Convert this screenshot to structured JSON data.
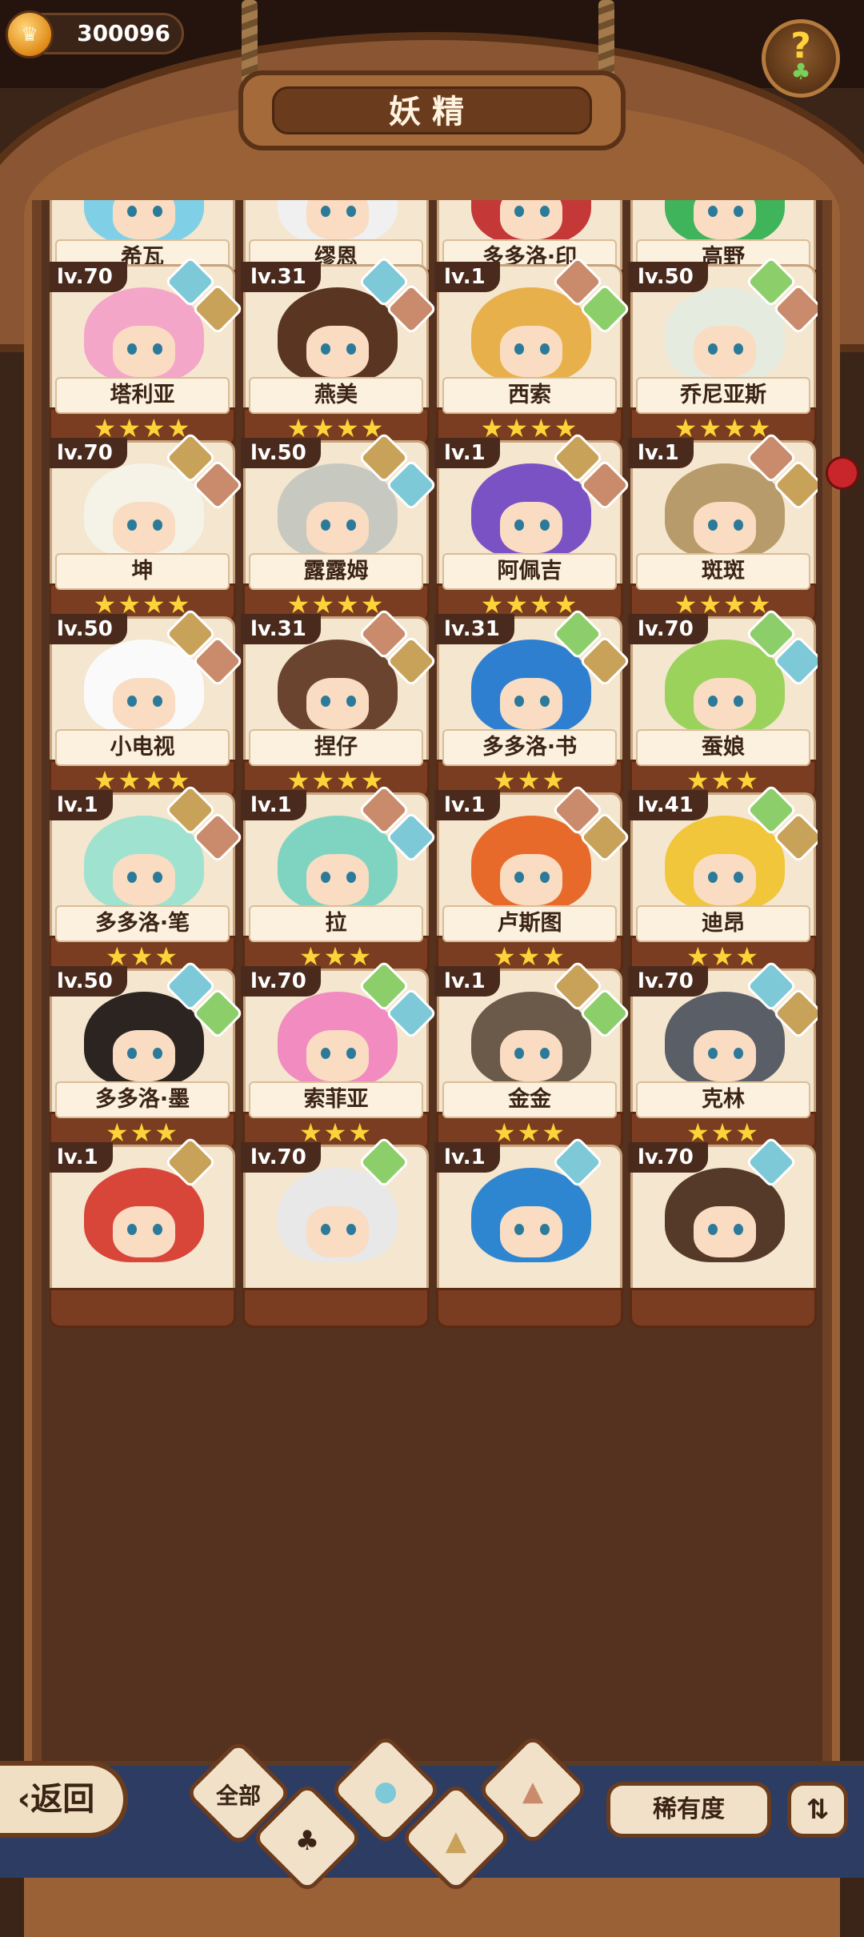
{
  "header": {
    "currency_amount": "300096",
    "title": "妖精",
    "help_symbol": "?"
  },
  "footer": {
    "back_label": "返回",
    "filter_all_label": "全部",
    "rarity_label": "稀有度",
    "sort_symbol": "⇅"
  },
  "colors": {
    "element_water": "#7dc9d8",
    "element_earth": "#c9a25a",
    "element_plant": "#8ccf6a",
    "element_fire": "#c98b6b"
  },
  "cards": [
    {
      "name": "希瓦",
      "level": "",
      "stars": "★★★★★",
      "elements": []
    },
    {
      "name": "缪恩",
      "level": "",
      "stars": "★★★★",
      "elements": []
    },
    {
      "name": "多多洛·印",
      "level": "",
      "stars": "★★★★",
      "elements": []
    },
    {
      "name": "高野",
      "level": "",
      "stars": "★★★★",
      "elements": []
    },
    {
      "name": "塔利亚",
      "level": "lv.70",
      "stars": "★★★★",
      "elements": [
        "water",
        "earth"
      ]
    },
    {
      "name": "燕美",
      "level": "lv.31",
      "stars": "★★★★",
      "elements": [
        "water",
        "fire"
      ]
    },
    {
      "name": "西索",
      "level": "lv.1",
      "stars": "★★★★",
      "elements": [
        "fire",
        "plant"
      ]
    },
    {
      "name": "乔尼亚斯",
      "level": "lv.50",
      "stars": "★★★★",
      "elements": [
        "plant",
        "fire"
      ]
    },
    {
      "name": "坤",
      "level": "lv.70",
      "stars": "★★★★",
      "elements": [
        "earth",
        "fire"
      ]
    },
    {
      "name": "露露姆",
      "level": "lv.50",
      "stars": "★★★★",
      "elements": [
        "earth",
        "water"
      ]
    },
    {
      "name": "阿佩吉",
      "level": "lv.1",
      "stars": "★★★★",
      "elements": [
        "earth",
        "fire"
      ]
    },
    {
      "name": "斑斑",
      "level": "lv.1",
      "stars": "★★★★",
      "elements": [
        "fire",
        "earth"
      ]
    },
    {
      "name": "小电视",
      "level": "lv.50",
      "stars": "★★★★",
      "elements": [
        "earth",
        "fire"
      ]
    },
    {
      "name": "捏仔",
      "level": "lv.31",
      "stars": "★★★★",
      "elements": [
        "fire",
        "earth"
      ]
    },
    {
      "name": "多多洛·书",
      "level": "lv.31",
      "stars": "★★★",
      "elements": [
        "plant",
        "earth"
      ]
    },
    {
      "name": "蚕娘",
      "level": "lv.70",
      "stars": "★★★",
      "elements": [
        "plant",
        "water"
      ]
    },
    {
      "name": "多多洛·笔",
      "level": "lv.1",
      "stars": "★★★",
      "elements": [
        "earth",
        "fire"
      ]
    },
    {
      "name": "拉",
      "level": "lv.1",
      "stars": "★★★",
      "elements": [
        "fire",
        "water"
      ]
    },
    {
      "name": "卢斯图",
      "level": "lv.1",
      "stars": "★★★",
      "elements": [
        "fire",
        "earth"
      ]
    },
    {
      "name": "迪昂",
      "level": "lv.41",
      "stars": "★★★",
      "elements": [
        "plant",
        "earth"
      ]
    },
    {
      "name": "多多洛·墨",
      "level": "lv.50",
      "stars": "★★★",
      "elements": [
        "water",
        "plant"
      ]
    },
    {
      "name": "索菲亚",
      "level": "lv.70",
      "stars": "★★★",
      "elements": [
        "plant",
        "water"
      ]
    },
    {
      "name": "金金",
      "level": "lv.1",
      "stars": "★★★",
      "elements": [
        "earth",
        "plant"
      ]
    },
    {
      "name": "克林",
      "level": "lv.70",
      "stars": "★★★",
      "elements": [
        "water",
        "earth"
      ]
    },
    {
      "name": "",
      "level": "lv.1",
      "stars": "",
      "elements": [
        "earth"
      ]
    },
    {
      "name": "",
      "level": "lv.70",
      "stars": "",
      "elements": [
        "plant"
      ]
    },
    {
      "name": "",
      "level": "lv.1",
      "stars": "",
      "elements": [
        "water"
      ]
    },
    {
      "name": "",
      "level": "lv.70",
      "stars": "",
      "elements": [
        "water"
      ]
    }
  ]
}
